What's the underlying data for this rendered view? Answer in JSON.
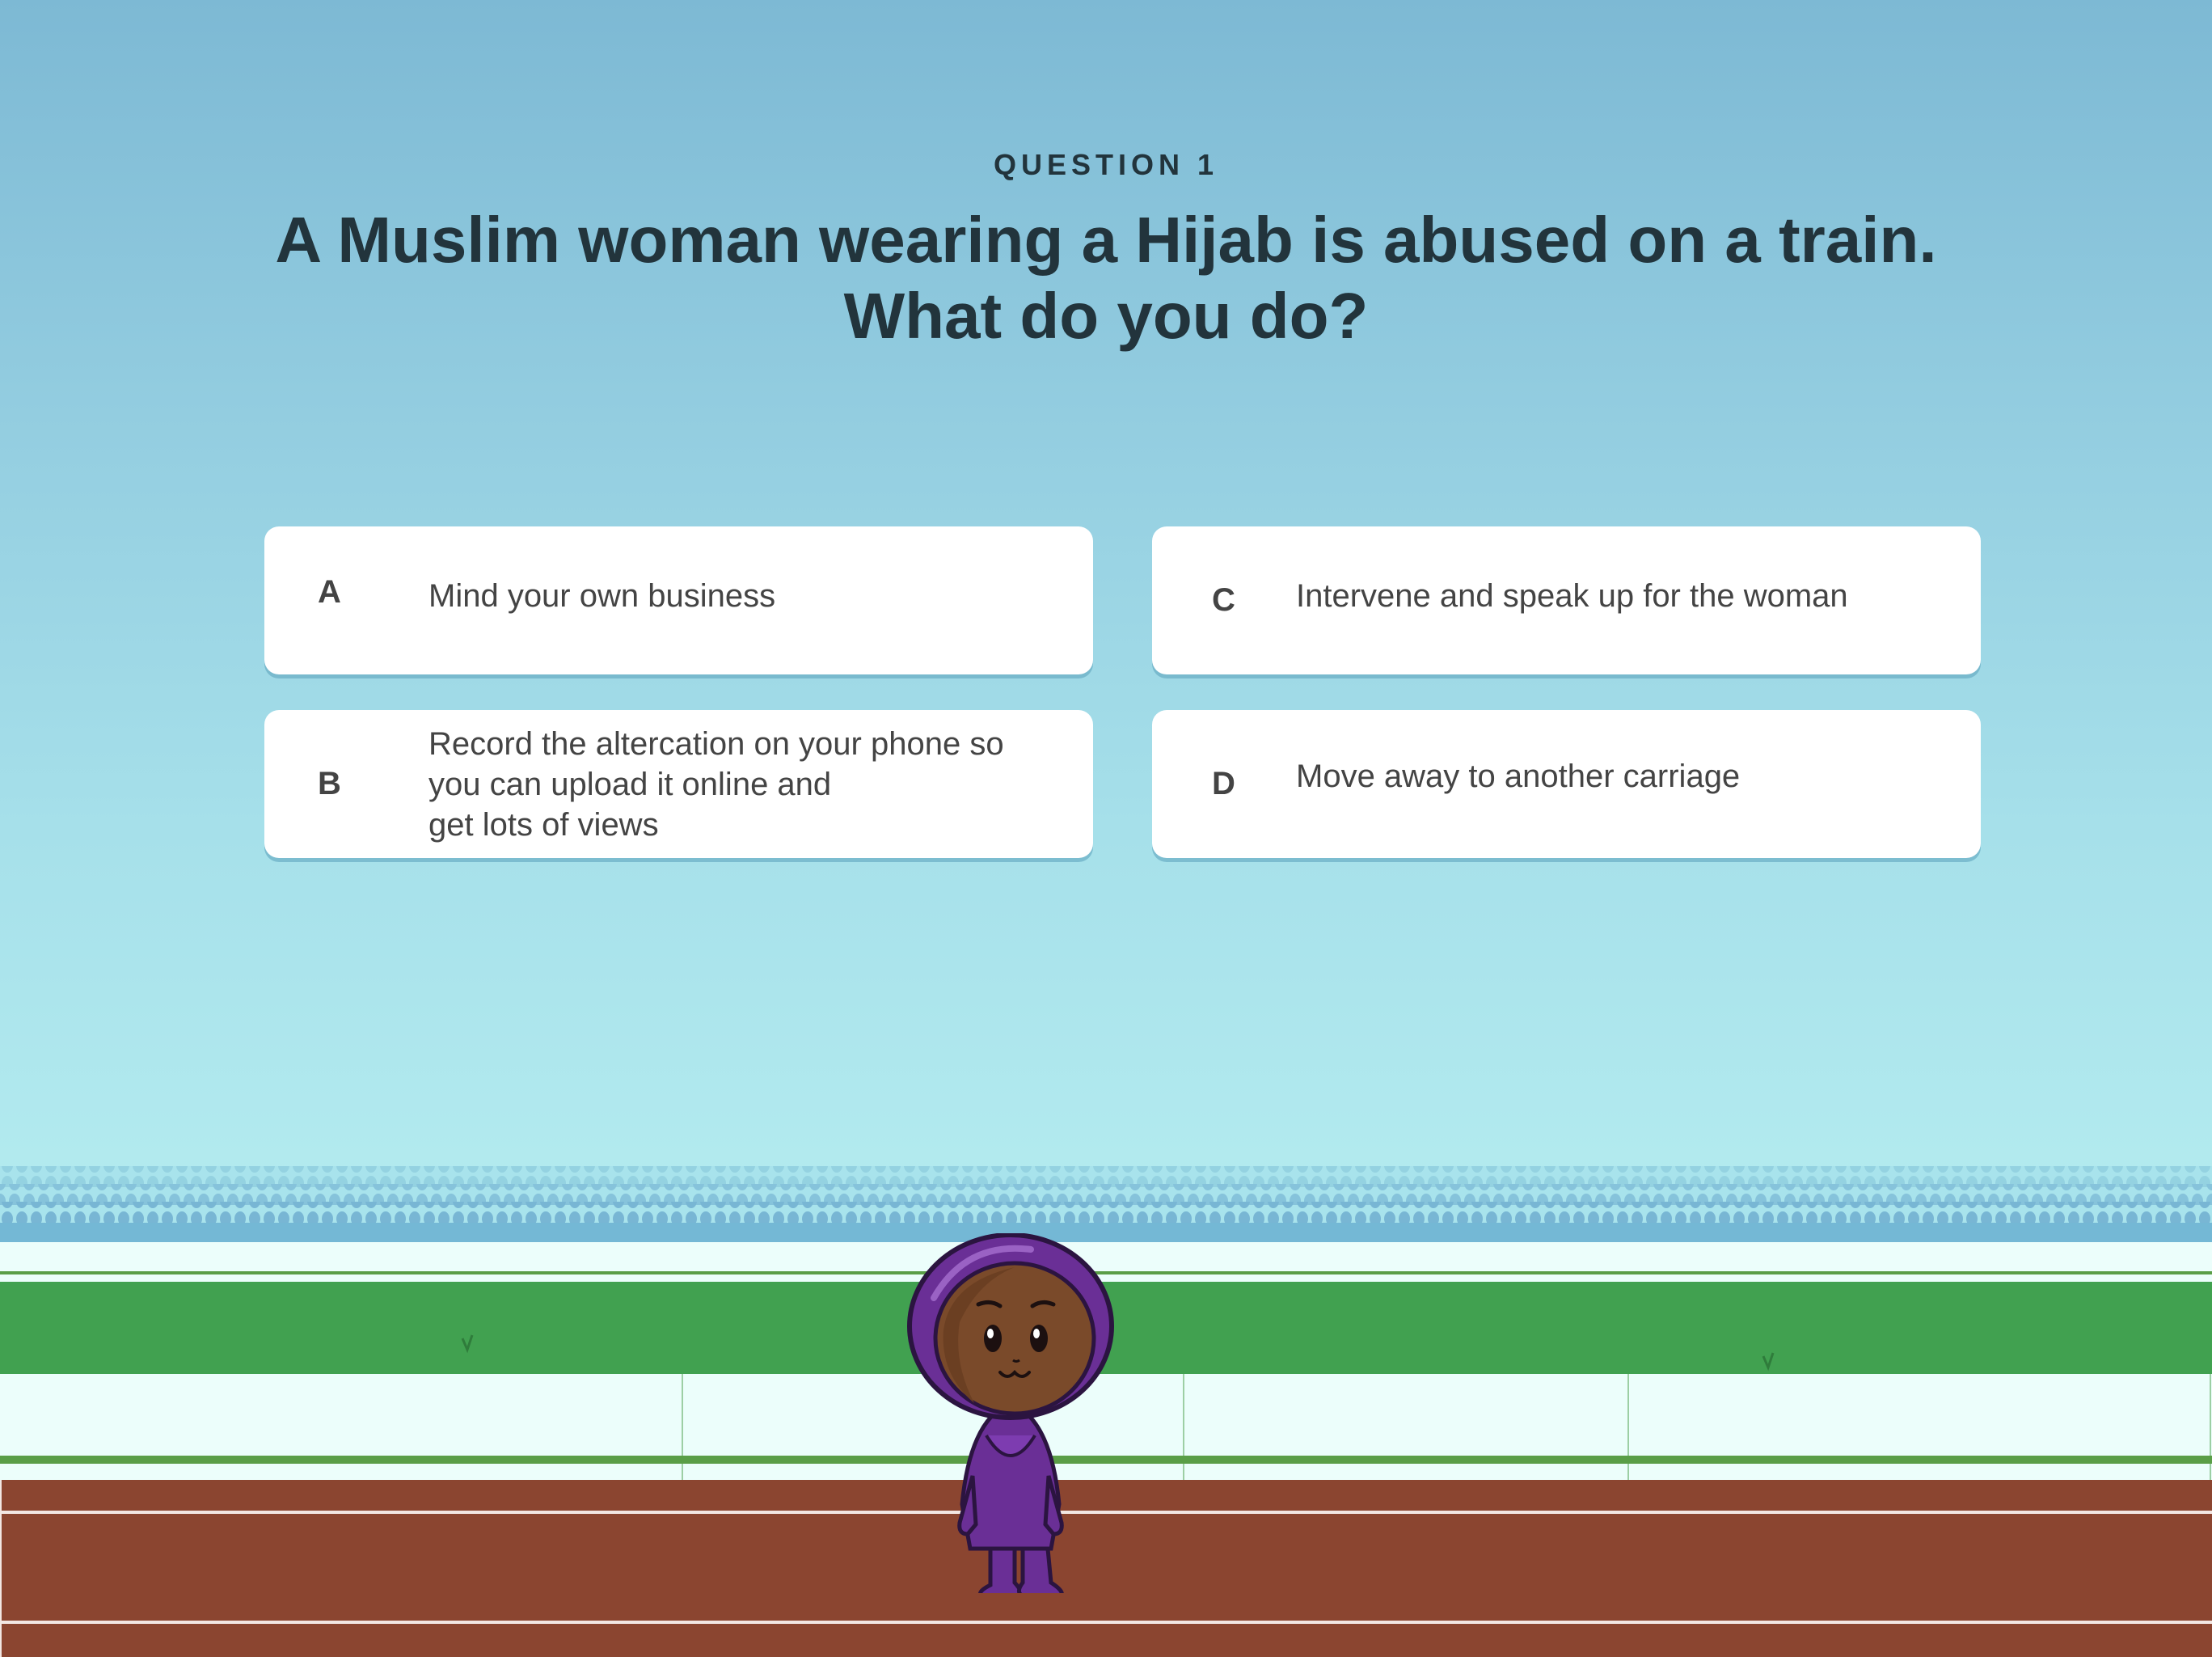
{
  "question": {
    "label": "QUESTION 1",
    "line1": "A Muslim woman wearing a Hijab is abused on a train.",
    "line2": "What do you do?"
  },
  "answers": [
    {
      "letter": "A",
      "text": "Mind your own business"
    },
    {
      "letter": "B",
      "text": "Record the altercation on your phone so\nyou can upload it online and\nget lots of views"
    },
    {
      "letter": "C",
      "text": "Intervene and speak up for the woman"
    },
    {
      "letter": "D",
      "text": "Move away to another carriage"
    }
  ],
  "colors": {
    "sky_top": "#7db9d4",
    "sky_bottom": "#b6edf0",
    "text_dark": "#22343c",
    "grass": "#41a150",
    "track": "#8b4530",
    "hijab": "#6a2f96",
    "skin": "#7a4a2a"
  },
  "character": {
    "name": "hijab-girl-character"
  }
}
